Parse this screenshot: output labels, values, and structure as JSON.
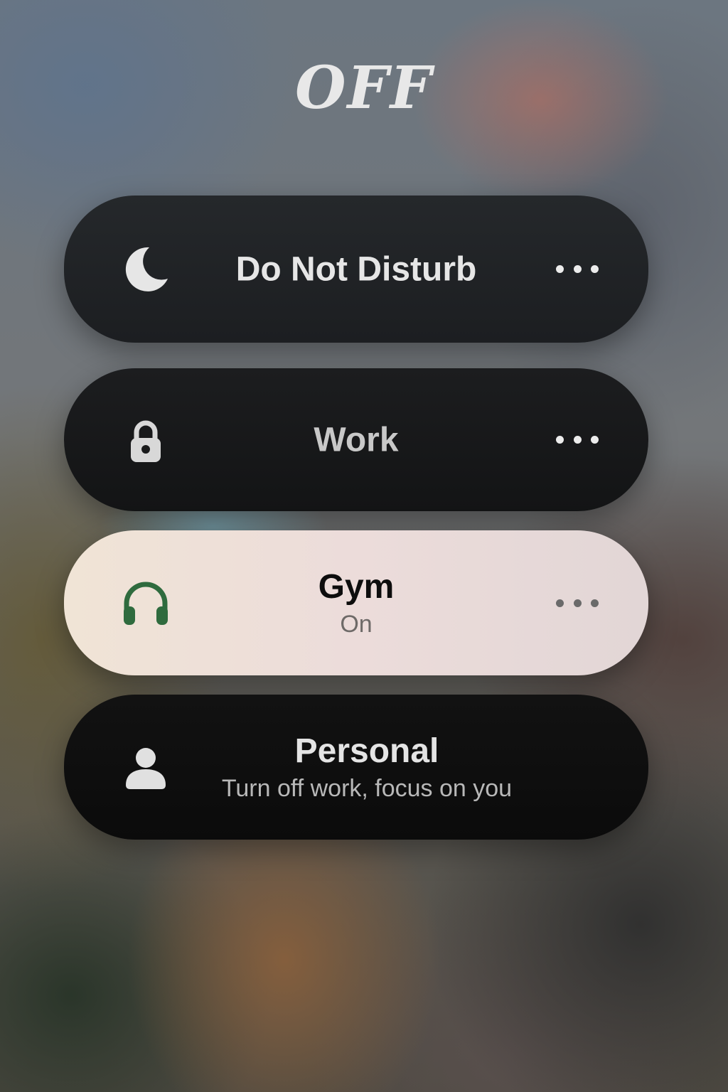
{
  "status": {
    "title": "OFF"
  },
  "focus_modes": [
    {
      "label": "Do Not Disturb",
      "subtitle": "",
      "icon": "moon-icon",
      "icon_color": "#e6e6e6",
      "has_more": true,
      "active": false
    },
    {
      "label": "Work",
      "subtitle": "",
      "icon": "lock-icon",
      "icon_color": "#d8d8d8",
      "has_more": true,
      "active": false
    },
    {
      "label": "Gym",
      "subtitle": "On",
      "icon": "headphones-icon",
      "icon_color": "#2f6b3e",
      "has_more": true,
      "active": true
    },
    {
      "label": "Personal",
      "subtitle": "Turn off work, focus on you",
      "icon": "person-icon",
      "icon_color": "#e0e0e0",
      "has_more": false,
      "active": false
    }
  ],
  "colors": {
    "active_card": "#efe2d8",
    "inactive_card": "#1e2023",
    "gym_accent": "#2f6b3e"
  }
}
